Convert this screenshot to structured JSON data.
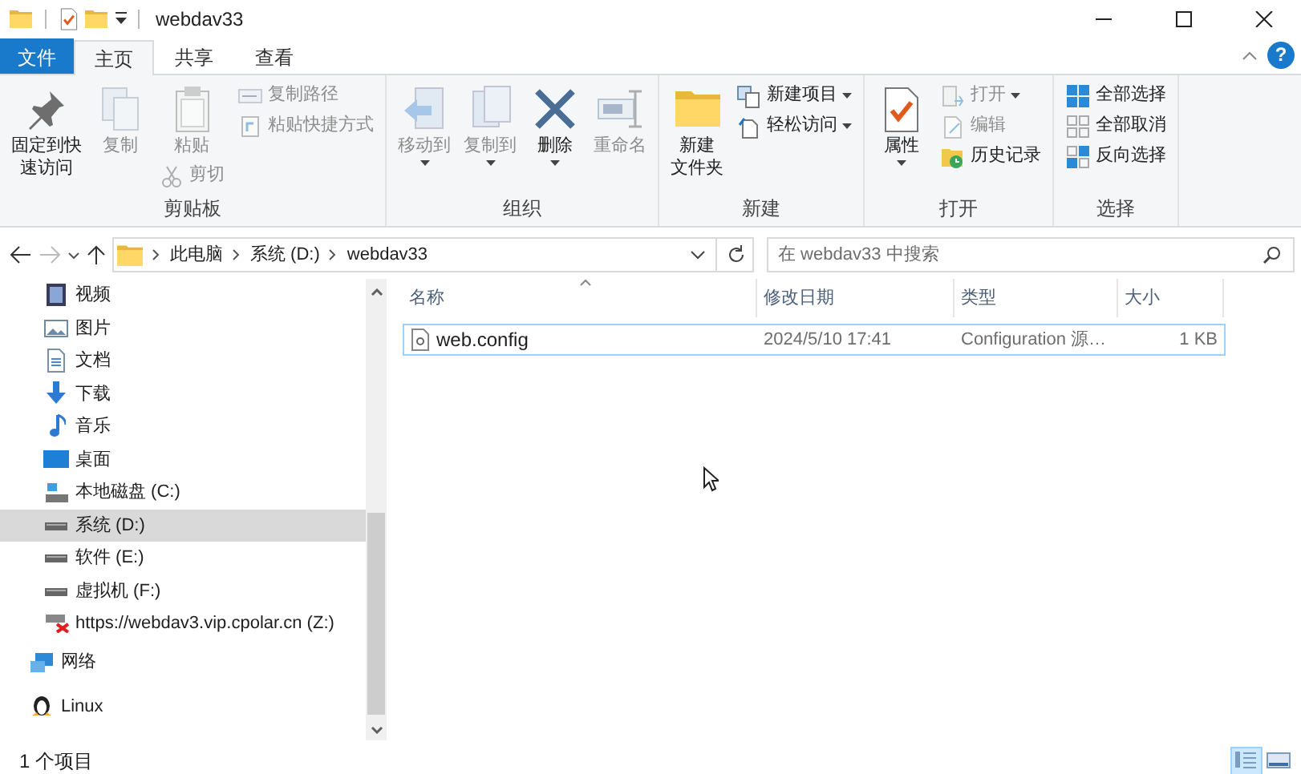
{
  "window": {
    "title": "webdav33",
    "help": "?"
  },
  "tabs": [
    {
      "label": "文件",
      "kind": "file",
      "selected": false
    },
    {
      "label": "主页",
      "kind": "tab",
      "selected": true
    },
    {
      "label": "共享",
      "kind": "tab",
      "selected": false
    },
    {
      "label": "查看",
      "kind": "tab",
      "selected": false
    }
  ],
  "ribbon": {
    "groups": [
      {
        "label": "剪贴板",
        "columns": [
          [
            {
              "lines": [
                "固定到快",
                "速访问"
              ],
              "kind": "large",
              "disabled": false,
              "dropdown": false
            }
          ],
          [
            {
              "label": "复制",
              "kind": "large",
              "disabled": true,
              "dropdown": false
            }
          ],
          [
            {
              "label": "粘贴",
              "kind": "large",
              "disabled": true,
              "dropdown": false
            },
            {
              "label": "剪切",
              "kind": "small",
              "disabled": true,
              "dropdown": false
            }
          ],
          [
            {
              "label": "复制路径",
              "kind": "small",
              "disabled": true,
              "dropdown": false
            },
            {
              "label": "粘贴快捷方式",
              "kind": "small",
              "disabled": true,
              "dropdown": false
            }
          ]
        ]
      },
      {
        "label": "组织",
        "columns": [
          [
            {
              "label": "移动到",
              "kind": "large",
              "disabled": true,
              "dropdown": true
            }
          ],
          [
            {
              "label": "复制到",
              "kind": "large",
              "disabled": true,
              "dropdown": true
            }
          ],
          [
            {
              "label": "删除",
              "kind": "large",
              "disabled": false,
              "dropdown": true
            }
          ],
          [
            {
              "label": "重命名",
              "kind": "large",
              "disabled": true,
              "dropdown": false
            }
          ]
        ]
      },
      {
        "label": "新建",
        "columns": [
          [
            {
              "lines": [
                "新建",
                "文件夹"
              ],
              "kind": "large",
              "disabled": false,
              "dropdown": false
            }
          ],
          [
            {
              "label": "新建项目",
              "kind": "small",
              "disabled": false,
              "dropdown": true
            },
            {
              "label": "轻松访问",
              "kind": "small",
              "disabled": false,
              "dropdown": true
            }
          ]
        ]
      },
      {
        "label": "打开",
        "columns": [
          [
            {
              "label": "属性",
              "kind": "large",
              "disabled": false,
              "dropdown": true
            }
          ],
          [
            {
              "label": "打开",
              "kind": "small",
              "disabled": true,
              "dropdown": true
            },
            {
              "label": "编辑",
              "kind": "small",
              "disabled": true,
              "dropdown": false
            },
            {
              "label": "历史记录",
              "kind": "small",
              "disabled": false,
              "dropdown": false
            }
          ]
        ]
      },
      {
        "label": "选择",
        "columns": [
          [
            {
              "label": "全部选择",
              "kind": "small",
              "disabled": false,
              "dropdown": false
            },
            {
              "label": "全部取消",
              "kind": "small",
              "disabled": false,
              "dropdown": false
            },
            {
              "label": "反向选择",
              "kind": "small",
              "disabled": false,
              "dropdown": false
            }
          ]
        ]
      }
    ]
  },
  "address_bar": {
    "path": [
      "此电脑",
      "系统 (D:)",
      "webdav33"
    ]
  },
  "search": {
    "placeholder": "在 webdav33 中搜索"
  },
  "navigation": {
    "nested_items": [
      {
        "label": "视频",
        "kind": "video",
        "selected": false
      },
      {
        "label": "图片",
        "kind": "pictures",
        "selected": false
      },
      {
        "label": "文档",
        "kind": "documents",
        "selected": false
      },
      {
        "label": "下载",
        "kind": "download",
        "selected": false
      },
      {
        "label": "音乐",
        "kind": "music",
        "selected": false
      },
      {
        "label": "桌面",
        "kind": "desktop",
        "selected": false
      },
      {
        "label": "本地磁盘 (C:)",
        "kind": "sysdrive",
        "selected": false
      },
      {
        "label": "系统 (D:)",
        "kind": "drive",
        "selected": true
      },
      {
        "label": "软件 (E:)",
        "kind": "drive",
        "selected": false
      },
      {
        "label": "虚拟机 (F:)",
        "kind": "drive",
        "selected": false
      },
      {
        "label": "https://webdav3.vip.cpolar.cn (Z:)",
        "kind": "netdrive",
        "selected": false
      }
    ],
    "items": [
      {
        "label": "网络",
        "kind": "network",
        "selected": false
      },
      {
        "label": "Linux",
        "kind": "linux",
        "selected": false
      }
    ]
  },
  "file_list": {
    "columns": [
      {
        "label": "名称",
        "sorted": true
      },
      {
        "label": "修改日期",
        "sorted": false
      },
      {
        "label": "类型",
        "sorted": false
      },
      {
        "label": "大小",
        "sorted": false
      }
    ],
    "rows": [
      {
        "name": "web.config",
        "date": "2024/5/10 17:41",
        "type": "Configuration 源…",
        "size": "1 KB",
        "focused": true,
        "selected": false
      }
    ]
  },
  "status_bar": {
    "item_count": "1 个项目",
    "views": [
      {
        "kind": "details",
        "selected": true
      },
      {
        "kind": "large-icons",
        "selected": false
      }
    ]
  }
}
